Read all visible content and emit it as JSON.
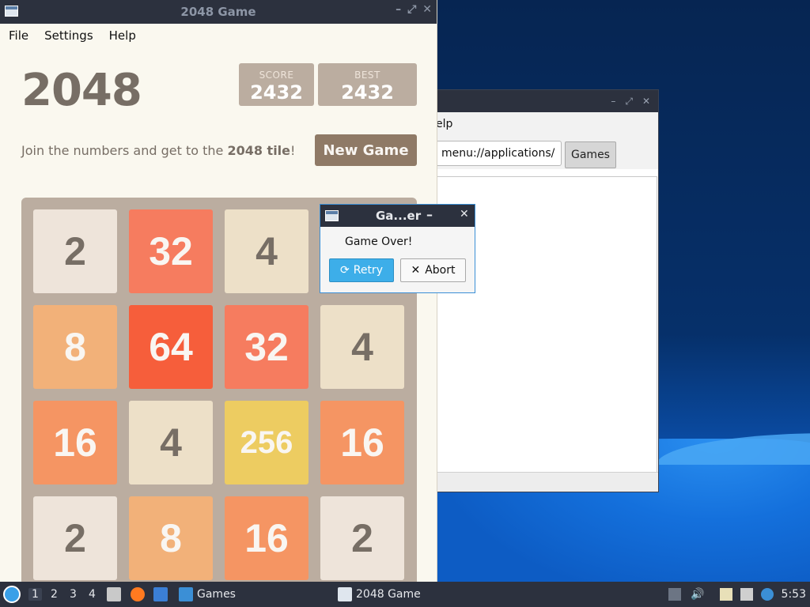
{
  "desktop": {
    "bg_color": "#062552",
    "accent_color": "#0b5fc8"
  },
  "background_window": {
    "menu_fragment": "elp",
    "path": "menu://applications/",
    "games_button": "Games"
  },
  "main_window": {
    "title": "2048 Game",
    "menu": [
      "File",
      "Settings",
      "Help"
    ]
  },
  "game": {
    "title": "2048",
    "score_label": "SCORE",
    "score_value": "2432",
    "best_label": "BEST",
    "best_value": "2432",
    "intro_prefix": "Join the numbers and get to the ",
    "intro_bold": "2048 tile",
    "intro_suffix": "!",
    "new_game": "New Game",
    "tiles": [
      [
        "2",
        "32",
        "4",
        ""
      ],
      [
        "8",
        "64",
        "32",
        "4"
      ],
      [
        "16",
        "4",
        "256",
        "16"
      ],
      [
        "2",
        "8",
        "16",
        "2"
      ]
    ]
  },
  "dialog": {
    "title": "Ga...er",
    "message": "Game Over!",
    "retry": "Retry",
    "abort": "Abort"
  },
  "taskbar": {
    "workspaces": [
      "1",
      "2",
      "3",
      "4"
    ],
    "tasks": [
      "Games",
      "2048 Game"
    ],
    "clock": "5:53"
  }
}
